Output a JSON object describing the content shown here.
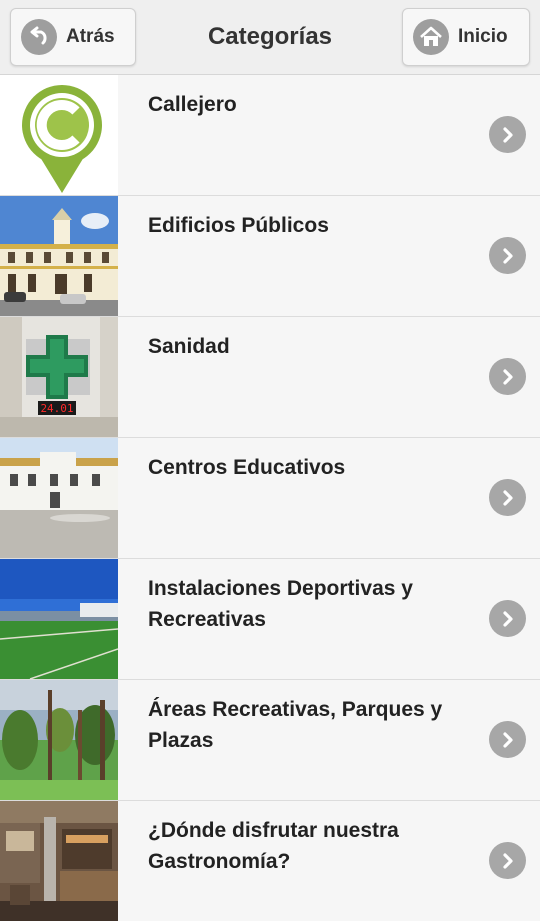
{
  "header": {
    "back_label": "Atrás",
    "title": "Categorías",
    "home_label": "Inicio"
  },
  "categories": [
    {
      "label": "Callejero",
      "image": "map-pin-logo"
    },
    {
      "label": "Edificios Públicos",
      "image": "town-hall-photo"
    },
    {
      "label": "Sanidad",
      "image": "pharmacy-cross-photo"
    },
    {
      "label": "Centros Educativos",
      "image": "school-building-photo"
    },
    {
      "label": "Instalaciones Deportivas y Recreativas",
      "image": "sports-field-photo"
    },
    {
      "label": "Áreas Recreativas, Parques y Plazas",
      "image": "park-trees-photo"
    },
    {
      "label": "¿Dónde disfrutar nuestra Gastronomía?",
      "image": "restaurant-bar-photo"
    }
  ],
  "icons": {
    "back": "back-arrow-icon",
    "home": "home-icon",
    "row_arrow": "chevron-right-icon"
  },
  "colors": {
    "logo_green": "#8ab33a",
    "icon_grey": "#a7a7a7"
  }
}
